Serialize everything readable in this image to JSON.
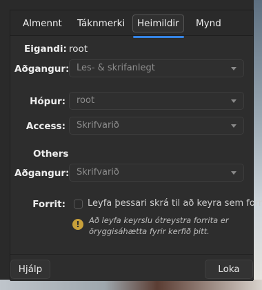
{
  "tabs": [
    {
      "label": "Almennt",
      "active": false
    },
    {
      "label": "Táknmerki",
      "active": false
    },
    {
      "label": "Heimildir",
      "active": true
    },
    {
      "label": "Mynd",
      "active": false
    }
  ],
  "owner": {
    "label": "Eigandi:",
    "value": "root",
    "access_label": "Aðgangur:",
    "access_value": "Les- & skrifanlegt"
  },
  "group": {
    "label": "Hópur:",
    "value": "root",
    "access_label": "Access:",
    "access_value": "Skrifvarið"
  },
  "others": {
    "heading": "Others",
    "access_label": "Aðgangur:",
    "access_value": "Skrifvarið"
  },
  "program": {
    "label": "Forrit:",
    "checkbox_label": "Leyfa þessari skrá til að keyra sem forrit",
    "checked": false,
    "warning": "Að leyfa keyrslu ótreystra forrita er öryggisáhætta fyrir kerfið þitt."
  },
  "footer": {
    "help_label": "Hjálp",
    "close_label": "Loka"
  },
  "colors": {
    "accent": "#3584e4",
    "warning": "#c8a03a"
  }
}
